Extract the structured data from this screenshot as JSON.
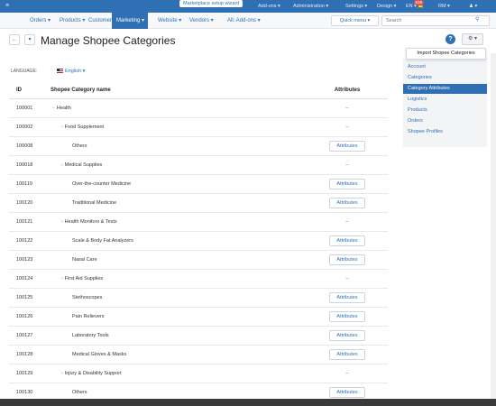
{
  "topbar": {
    "wizard": "Marketplace setup wizard",
    "addons": "Add-ons ▾",
    "administration": "Administration ▾",
    "settings": "Settings ▾",
    "design": "Design ▾",
    "lang": "EN ▾",
    "badge": "639",
    "user": "RM ▾",
    "account": "♟ ▾"
  },
  "menu": {
    "orders": "Orders ▾",
    "products": "Products ▾",
    "customers": "Customers ▾",
    "marketing": "Marketing ▾",
    "website": "Website ▾",
    "vendors": "Vendors ▾",
    "all_addons": "All: Add-ons ▾",
    "quick_menu": "Quick menu ▾",
    "search_placeholder": "Search"
  },
  "header": {
    "title": "Manage Shopee Categories",
    "import": "Import Shopee Categories"
  },
  "language": {
    "label": "LANGUAGE:",
    "value": "English ▾"
  },
  "table": {
    "headers": {
      "id": "ID",
      "name": "Shopee Category name",
      "attributes": "Attributes"
    },
    "attr_button": "Attributes",
    "dash": "--",
    "rows": [
      {
        "id": "100001",
        "name": "Health",
        "level": 0,
        "type": "parent"
      },
      {
        "id": "100002",
        "name": "Food Supplement",
        "level": 1,
        "type": "parent"
      },
      {
        "id": "100008",
        "name": "Others",
        "level": 2,
        "type": "leaf"
      },
      {
        "id": "100018",
        "name": "Medical Supplies",
        "level": 1,
        "type": "parent"
      },
      {
        "id": "100119",
        "name": "Over-the-counter Medicine",
        "level": 2,
        "type": "leaf"
      },
      {
        "id": "100120",
        "name": "Traditional Medicine",
        "level": 2,
        "type": "leaf"
      },
      {
        "id": "100121",
        "name": "Health Monitors & Tests",
        "level": 1,
        "type": "parent"
      },
      {
        "id": "100122",
        "name": "Scale & Body Fat Analyzers",
        "level": 2,
        "type": "leaf"
      },
      {
        "id": "100123",
        "name": "Nasal Care",
        "level": 2,
        "type": "leaf"
      },
      {
        "id": "100124",
        "name": "First Aid Supplies",
        "level": 1,
        "type": "parent"
      },
      {
        "id": "100125",
        "name": "Stethoscopes",
        "level": 2,
        "type": "leaf"
      },
      {
        "id": "100126",
        "name": "Pain Relievers",
        "level": 2,
        "type": "leaf"
      },
      {
        "id": "100127",
        "name": "Laboratory Tools",
        "level": 2,
        "type": "leaf"
      },
      {
        "id": "100128",
        "name": "Medical Gloves & Masks",
        "level": 2,
        "type": "leaf"
      },
      {
        "id": "100129",
        "name": "Injury & Disability Support",
        "level": 1,
        "type": "parent"
      },
      {
        "id": "100130",
        "name": "Others",
        "level": 2,
        "type": "leaf"
      }
    ]
  },
  "sidebar": {
    "items": [
      {
        "label": "Account",
        "active": false
      },
      {
        "label": "Categories",
        "active": false
      },
      {
        "label": "Category Attributes",
        "active": true
      },
      {
        "label": "Logistics",
        "active": false
      },
      {
        "label": "Products",
        "active": false
      },
      {
        "label": "Orders",
        "active": false
      },
      {
        "label": "Shopee Profiles",
        "active": false
      }
    ]
  },
  "colors": {
    "brand": "#2f6fb4",
    "badge": "#d9534f"
  }
}
